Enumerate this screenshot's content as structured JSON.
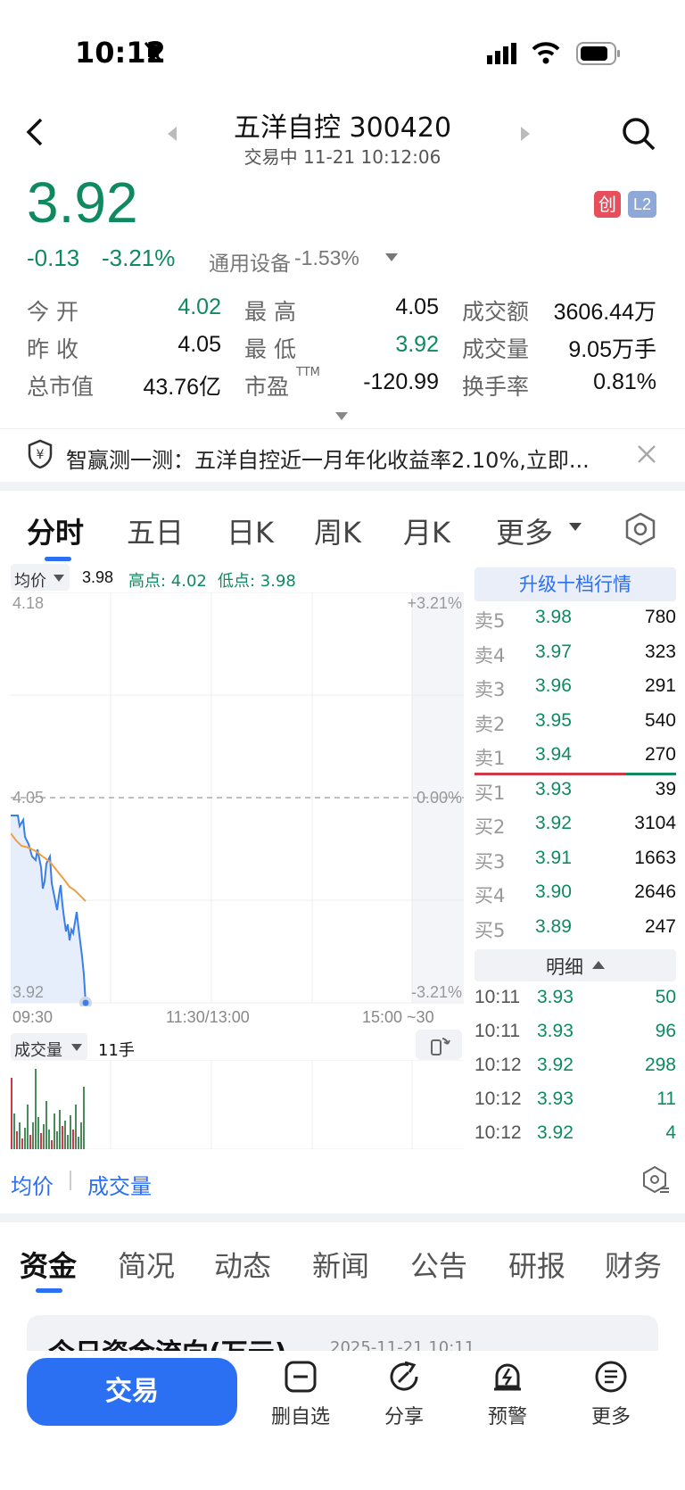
{
  "status_bar": {
    "time": "10:12"
  },
  "header": {
    "title": "五洋自控 300420",
    "subtitle": "交易中 11-21 10:12:06",
    "badge_chuang": "创",
    "badge_level": "L2"
  },
  "quote": {
    "price": "3.92",
    "change": "-0.13",
    "change_pct": "-3.21%",
    "sector": "通用设备",
    "sector_pct": "-1.53%"
  },
  "stats": [
    {
      "label": "今 开",
      "value": "4.02",
      "color": "g"
    },
    {
      "label": "最 高",
      "value": "4.05",
      "color": "k"
    },
    {
      "label": "成交额",
      "value": "3606.44万",
      "color": "k"
    },
    {
      "label": "昨 收",
      "value": "4.05",
      "color": "k"
    },
    {
      "label": "最 低",
      "value": "3.92",
      "color": "g"
    },
    {
      "label": "成交量",
      "value": "9.05万手",
      "color": "k"
    },
    {
      "label": "总市值",
      "value": "43.76亿",
      "color": "k"
    },
    {
      "label": "市盈",
      "label_sup": "TTM",
      "value": "-120.99",
      "color": "k"
    },
    {
      "label": "换手率",
      "value": "0.81%",
      "color": "k"
    }
  ],
  "banner": {
    "text": "智赢测一测：五洋自控近一月年化收益率2.10%,立即..."
  },
  "chart_tabs": [
    "分时",
    "五日",
    "日K",
    "周K",
    "月K",
    "更多"
  ],
  "chart_header": {
    "avg_label": "均价",
    "avg_value": "3.98",
    "high": "高点: 4.02",
    "low": "低点: 3.98"
  },
  "chart_axes": {
    "y_top": "4.18",
    "y_mid": "4.05",
    "y_bottom": "3.92",
    "pct_top": "+3.21%",
    "pct_mid": "0.00%",
    "pct_bottom": "-3.21%",
    "x_start": "09:30",
    "x_mid": "11:30/13:00",
    "x_end": "15:00 ~30"
  },
  "volume_header": {
    "label": "成交量",
    "value": "11手"
  },
  "upgrade_label": "升级十档行情",
  "order_book": {
    "asks": [
      {
        "label": "卖5",
        "price": "3.98",
        "vol": "780"
      },
      {
        "label": "卖4",
        "price": "3.97",
        "vol": "323"
      },
      {
        "label": "卖3",
        "price": "3.96",
        "vol": "291"
      },
      {
        "label": "卖2",
        "price": "3.95",
        "vol": "540"
      },
      {
        "label": "卖1",
        "price": "3.94",
        "vol": "270"
      }
    ],
    "bids": [
      {
        "label": "买1",
        "price": "3.93",
        "vol": "39"
      },
      {
        "label": "买2",
        "price": "3.92",
        "vol": "3104"
      },
      {
        "label": "买3",
        "price": "3.91",
        "vol": "1663"
      },
      {
        "label": "买4",
        "price": "3.90",
        "vol": "2646"
      },
      {
        "label": "买5",
        "price": "3.89",
        "vol": "247"
      }
    ]
  },
  "detail": {
    "label": "明细",
    "rows": [
      {
        "time": "10:11",
        "price": "3.93",
        "vol": "50"
      },
      {
        "time": "10:11",
        "price": "3.93",
        "vol": "96"
      },
      {
        "time": "10:12",
        "price": "3.92",
        "vol": "298"
      },
      {
        "time": "10:12",
        "price": "3.93",
        "vol": "11"
      },
      {
        "time": "10:12",
        "price": "3.92",
        "vol": "4"
      }
    ]
  },
  "indicator_tabs": {
    "avg": "均价",
    "volume": "成交量"
  },
  "feature_tabs": [
    "资金",
    "简况",
    "动态",
    "新闻",
    "公告",
    "研报",
    "财务"
  ],
  "fund_card": {
    "title": "今日资金流向(万元)",
    "date": "2025-11-21 10:11"
  },
  "bottom_bar": {
    "trade": "交易",
    "remove": "删自选",
    "share": "分享",
    "alert": "预警",
    "more": "更多"
  },
  "colors": {
    "green": "#0f8a5f",
    "red": "#e03a3a",
    "blue": "#2b6ff2",
    "orange": "#f0a040"
  }
}
